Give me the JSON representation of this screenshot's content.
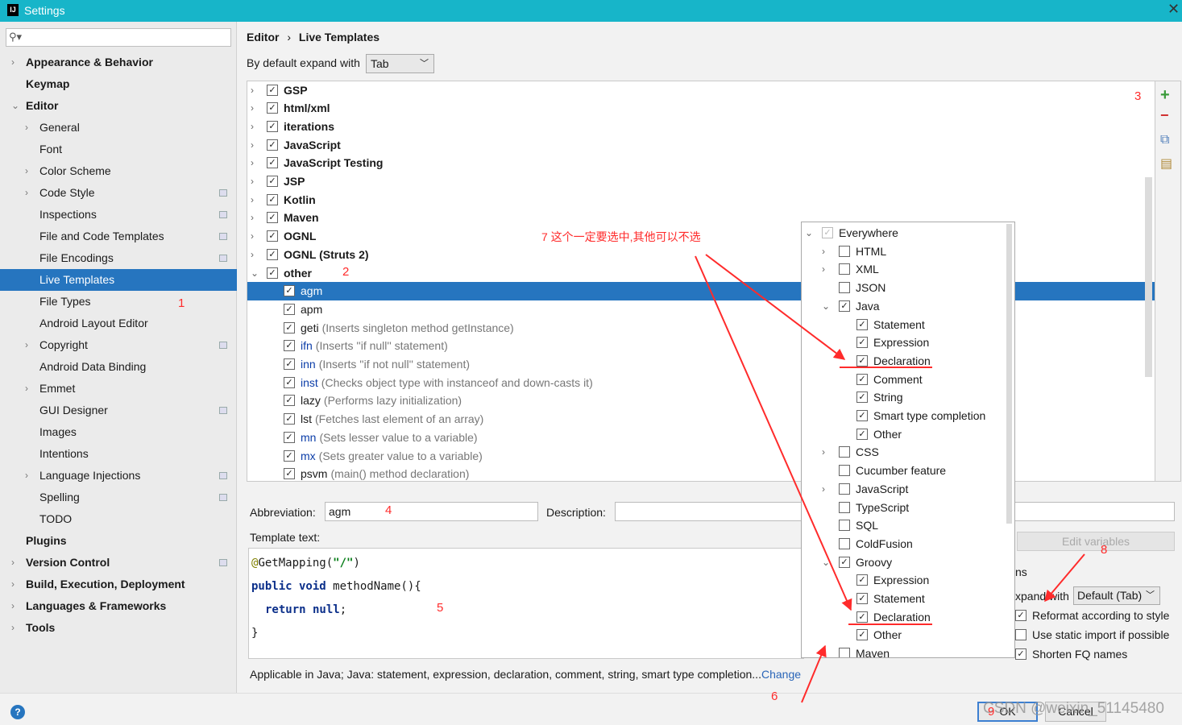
{
  "window": {
    "title": "Settings"
  },
  "search": {
    "placeholder": ""
  },
  "sidebar": {
    "items": [
      {
        "label": "Appearance & Behavior",
        "bold": true,
        "arrow": "›",
        "indent": 0
      },
      {
        "label": "Keymap",
        "bold": true,
        "arrow": "",
        "indent": 0
      },
      {
        "label": "Editor",
        "bold": true,
        "arrow": "⌄",
        "indent": 0
      },
      {
        "label": "General",
        "arrow": "›",
        "indent": 1
      },
      {
        "label": "Font",
        "arrow": "",
        "indent": 1
      },
      {
        "label": "Color Scheme",
        "arrow": "›",
        "indent": 1
      },
      {
        "label": "Code Style",
        "arrow": "›",
        "indent": 1,
        "cfg": true
      },
      {
        "label": "Inspections",
        "arrow": "",
        "indent": 1,
        "cfg": true
      },
      {
        "label": "File and Code Templates",
        "arrow": "",
        "indent": 1,
        "cfg": true
      },
      {
        "label": "File Encodings",
        "arrow": "",
        "indent": 1,
        "cfg": true
      },
      {
        "label": "Live Templates",
        "arrow": "",
        "indent": 1,
        "selected": true
      },
      {
        "label": "File Types",
        "arrow": "",
        "indent": 1
      },
      {
        "label": "Android Layout Editor",
        "arrow": "",
        "indent": 1
      },
      {
        "label": "Copyright",
        "arrow": "›",
        "indent": 1,
        "cfg": true
      },
      {
        "label": "Android Data Binding",
        "arrow": "",
        "indent": 1
      },
      {
        "label": "Emmet",
        "arrow": "›",
        "indent": 1
      },
      {
        "label": "GUI Designer",
        "arrow": "",
        "indent": 1,
        "cfg": true
      },
      {
        "label": "Images",
        "arrow": "",
        "indent": 1
      },
      {
        "label": "Intentions",
        "arrow": "",
        "indent": 1
      },
      {
        "label": "Language Injections",
        "arrow": "›",
        "indent": 1,
        "cfg": true
      },
      {
        "label": "Spelling",
        "arrow": "",
        "indent": 1,
        "cfg": true
      },
      {
        "label": "TODO",
        "arrow": "",
        "indent": 1
      },
      {
        "label": "Plugins",
        "bold": true,
        "arrow": "",
        "indent": 0
      },
      {
        "label": "Version Control",
        "bold": true,
        "arrow": "›",
        "indent": 0,
        "cfg": true
      },
      {
        "label": "Build, Execution, Deployment",
        "bold": true,
        "arrow": "›",
        "indent": 0
      },
      {
        "label": "Languages & Frameworks",
        "bold": true,
        "arrow": "›",
        "indent": 0
      },
      {
        "label": "Tools",
        "bold": true,
        "arrow": "›",
        "indent": 0
      }
    ]
  },
  "breadcrumb": {
    "part1": "Editor",
    "sep": "›",
    "part2": "Live Templates"
  },
  "expand": {
    "label": "By default expand with",
    "value": "Tab"
  },
  "templates": [
    {
      "name": "GSP",
      "group": true,
      "arrow": "›"
    },
    {
      "name": "html/xml",
      "group": true,
      "arrow": "›"
    },
    {
      "name": "iterations",
      "group": true,
      "arrow": "›"
    },
    {
      "name": "JavaScript",
      "group": true,
      "arrow": "›"
    },
    {
      "name": "JavaScript Testing",
      "group": true,
      "arrow": "›"
    },
    {
      "name": "JSP",
      "group": true,
      "arrow": "›"
    },
    {
      "name": "Kotlin",
      "group": true,
      "arrow": "›"
    },
    {
      "name": "Maven",
      "group": true,
      "arrow": "›"
    },
    {
      "name": "OGNL",
      "group": true,
      "arrow": "›"
    },
    {
      "name": "OGNL (Struts 2)",
      "group": true,
      "arrow": "›"
    },
    {
      "name": "other",
      "group": true,
      "arrow": "⌄"
    },
    {
      "name": "agm",
      "desc": "",
      "selected": true
    },
    {
      "name": "apm",
      "desc": ""
    },
    {
      "name": "geti",
      "desc": "(Inserts singleton method getInstance)"
    },
    {
      "name": "ifn",
      "desc": "(Inserts ''if null'' statement)",
      "kw": true
    },
    {
      "name": "inn",
      "desc": "(Inserts ''if not null'' statement)",
      "kw": true
    },
    {
      "name": "inst",
      "desc": "(Checks object type with instanceof and down-casts it)",
      "kw": true
    },
    {
      "name": "lazy",
      "desc": "(Performs lazy initialization)"
    },
    {
      "name": "lst",
      "desc": "(Fetches last element of an array)"
    },
    {
      "name": "mn",
      "desc": "(Sets lesser value to a variable)",
      "kw": true
    },
    {
      "name": "mx",
      "desc": "(Sets greater value to a variable)",
      "kw": true
    },
    {
      "name": "psvm",
      "desc": "(main() method declaration)"
    }
  ],
  "toolbar": {
    "add": "+",
    "remove": "−"
  },
  "abbreviation": {
    "label": "Abbreviation:",
    "value": "agm"
  },
  "description": {
    "label": "Description:",
    "value": ""
  },
  "template_text": {
    "label": "Template text:",
    "line1_annot": "@",
    "line1_rest": "GetMapping(",
    "line1_str": "\"/\"",
    "line1_end": ")",
    "line2_kw": "public void",
    "line2_rest": " methodName(){",
    "line3_kw": "return null",
    "line3_end": ";",
    "line4": "}"
  },
  "applicable": {
    "text": "Applicable in Java; Java: statement, expression, declaration, comment, string, smart type completion...",
    "link": "Change"
  },
  "options": {
    "edit_variables": "Edit variables",
    "options_title": "ns",
    "expand_label": "xpand with",
    "expand_value": "Default (Tab)",
    "reformat": "Reformat according to style",
    "static_import": "Use static import if possible",
    "shorten_fq": "Shorten FQ names"
  },
  "context_popup": {
    "items": [
      {
        "label": "Everywhere",
        "arrow": "⌄",
        "level": 0,
        "checked": true,
        "disabled": true
      },
      {
        "label": "HTML",
        "arrow": "›",
        "level": 1,
        "checked": false
      },
      {
        "label": "XML",
        "arrow": "›",
        "level": 1,
        "checked": false
      },
      {
        "label": "JSON",
        "arrow": "",
        "level": 1,
        "checked": false
      },
      {
        "label": "Java",
        "arrow": "⌄",
        "level": 1,
        "checked": true
      },
      {
        "label": "Statement",
        "arrow": "",
        "level": 2,
        "checked": true
      },
      {
        "label": "Expression",
        "arrow": "",
        "level": 2,
        "checked": true
      },
      {
        "label": "Declaration",
        "arrow": "",
        "level": 2,
        "checked": true
      },
      {
        "label": "Comment",
        "arrow": "",
        "level": 2,
        "checked": true
      },
      {
        "label": "String",
        "arrow": "",
        "level": 2,
        "checked": true
      },
      {
        "label": "Smart type completion",
        "arrow": "",
        "level": 2,
        "checked": true
      },
      {
        "label": "Other",
        "arrow": "",
        "level": 2,
        "checked": true
      },
      {
        "label": "CSS",
        "arrow": "›",
        "level": 1,
        "checked": false
      },
      {
        "label": "Cucumber feature",
        "arrow": "",
        "level": 1,
        "checked": false
      },
      {
        "label": "JavaScript",
        "arrow": "›",
        "level": 1,
        "checked": false
      },
      {
        "label": "TypeScript",
        "arrow": "",
        "level": 1,
        "checked": false
      },
      {
        "label": "SQL",
        "arrow": "",
        "level": 1,
        "checked": false
      },
      {
        "label": "ColdFusion",
        "arrow": "",
        "level": 1,
        "checked": false
      },
      {
        "label": "Groovy",
        "arrow": "⌄",
        "level": 1,
        "checked": true
      },
      {
        "label": "Expression",
        "arrow": "",
        "level": 2,
        "checked": true
      },
      {
        "label": "Statement",
        "arrow": "",
        "level": 2,
        "checked": true
      },
      {
        "label": "Declaration",
        "arrow": "",
        "level": 2,
        "checked": true
      },
      {
        "label": "Other",
        "arrow": "",
        "level": 2,
        "checked": true
      },
      {
        "label": "Maven",
        "arrow": "",
        "level": 1,
        "checked": false
      }
    ]
  },
  "annotations": {
    "n1": "1",
    "n2": "2",
    "n3": "3",
    "n4": "4",
    "n5": "5",
    "n6": "6",
    "n7": "7  这个一定要选中,其他可以不选",
    "n8": "8",
    "n9": "9",
    "color": "#ff2b2b"
  },
  "buttons": {
    "ok": "OK",
    "cancel": "Cancel",
    "help": "?"
  },
  "watermark": "CSDN @weixin_51145480",
  "colors": {
    "titlebar": "#17b5c9",
    "selection": "#2675bf",
    "keyword": "#0b3da8",
    "annotation": "#ff2b2b"
  }
}
